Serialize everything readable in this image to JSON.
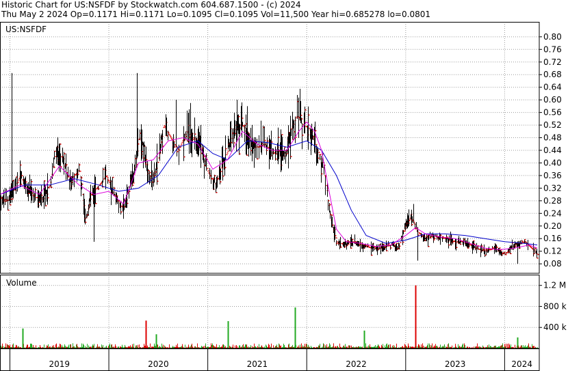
{
  "header": {
    "line1": "Historic Chart for US:NSFDF by Stockwatch.com 604.687.1500 - (c) 2024",
    "line2": "Thu May  2 2024   Op=0.1171  Hi=0.1171  Lo=0.1095  Cl=0.1095  Vol=11,500   Year hi=0.685278   lo=0.0801"
  },
  "colors": {
    "background": "#ffffff",
    "grid": "#9a9a9a",
    "border": "#000000",
    "price_bar": "#000000",
    "close_tick": "#dd0000",
    "ma_short": "#dd00dd",
    "ma_long": "#0000cc",
    "volume_up": "#22aa22",
    "volume_down": "#dd0000"
  },
  "chart_data": [
    {
      "type": "line",
      "name": "price",
      "title": "US:NSFDF",
      "ylim": [
        0.05,
        0.83
      ],
      "y_ticks": [
        "0.80",
        "0.76",
        "0.72",
        "0.68",
        "0.64",
        "0.60",
        "0.56",
        "0.52",
        "0.48",
        "0.44",
        "0.40",
        "0.36",
        "0.32",
        "0.28",
        "0.24",
        "0.20",
        "0.16",
        "0.12",
        "0.08"
      ],
      "x_labels": [
        "2019",
        "2020",
        "2021",
        "2022",
        "2023",
        "2024"
      ],
      "x_range": [
        2018.9,
        2024.35
      ],
      "year_boundaries": [
        2019.0,
        2020.0,
        2021.0,
        2022.0,
        2023.0,
        2024.0
      ],
      "price_anchors": [
        [
          2018.9,
          0.29
        ],
        [
          2018.98,
          0.28
        ],
        [
          2019.03,
          0.31
        ],
        [
          2019.1,
          0.36
        ],
        [
          2019.18,
          0.31
        ],
        [
          2019.25,
          0.29
        ],
        [
          2019.33,
          0.29
        ],
        [
          2019.4,
          0.33
        ],
        [
          2019.45,
          0.42
        ],
        [
          2019.52,
          0.42
        ],
        [
          2019.6,
          0.34
        ],
        [
          2019.7,
          0.38
        ],
        [
          2019.76,
          0.22
        ],
        [
          2019.82,
          0.3
        ],
        [
          2019.9,
          0.33
        ],
        [
          2019.97,
          0.36
        ],
        [
          2020.05,
          0.3
        ],
        [
          2020.15,
          0.25
        ],
        [
          2020.2,
          0.32
        ],
        [
          2020.25,
          0.37
        ],
        [
          2020.3,
          0.48
        ],
        [
          2020.35,
          0.46
        ],
        [
          2020.4,
          0.34
        ],
        [
          2020.48,
          0.38
        ],
        [
          2020.55,
          0.52
        ],
        [
          2020.62,
          0.48
        ],
        [
          2020.7,
          0.44
        ],
        [
          2020.78,
          0.5
        ],
        [
          2020.85,
          0.48
        ],
        [
          2020.92,
          0.46
        ],
        [
          2021.0,
          0.37
        ],
        [
          2021.08,
          0.33
        ],
        [
          2021.15,
          0.4
        ],
        [
          2021.2,
          0.44
        ],
        [
          2021.28,
          0.52
        ],
        [
          2021.35,
          0.52
        ],
        [
          2021.42,
          0.47
        ],
        [
          2021.5,
          0.45
        ],
        [
          2021.58,
          0.46
        ],
        [
          2021.65,
          0.43
        ],
        [
          2021.72,
          0.44
        ],
        [
          2021.8,
          0.43
        ],
        [
          2021.85,
          0.52
        ],
        [
          2021.9,
          0.55
        ],
        [
          2021.96,
          0.52
        ],
        [
          2022.02,
          0.51
        ],
        [
          2022.1,
          0.45
        ],
        [
          2022.17,
          0.38
        ],
        [
          2022.24,
          0.22
        ],
        [
          2022.3,
          0.15
        ],
        [
          2022.38,
          0.14
        ],
        [
          2022.45,
          0.15
        ],
        [
          2022.55,
          0.14
        ],
        [
          2022.65,
          0.13
        ],
        [
          2022.75,
          0.13
        ],
        [
          2022.85,
          0.14
        ],
        [
          2022.92,
          0.13
        ],
        [
          2023.0,
          0.2
        ],
        [
          2023.05,
          0.23
        ],
        [
          2023.12,
          0.18
        ],
        [
          2023.2,
          0.16
        ],
        [
          2023.28,
          0.17
        ],
        [
          2023.4,
          0.16
        ],
        [
          2023.5,
          0.15
        ],
        [
          2023.6,
          0.15
        ],
        [
          2023.7,
          0.13
        ],
        [
          2023.8,
          0.12
        ],
        [
          2023.9,
          0.13
        ],
        [
          2024.0,
          0.11
        ],
        [
          2024.1,
          0.14
        ],
        [
          2024.2,
          0.15
        ],
        [
          2024.3,
          0.12
        ],
        [
          2024.33,
          0.1095
        ]
      ],
      "ma_short": [
        [
          2018.9,
          0.3
        ],
        [
          2019.1,
          0.33
        ],
        [
          2019.3,
          0.3
        ],
        [
          2019.5,
          0.39
        ],
        [
          2019.7,
          0.33
        ],
        [
          2019.85,
          0.3
        ],
        [
          2020.0,
          0.31
        ],
        [
          2020.15,
          0.27
        ],
        [
          2020.3,
          0.4
        ],
        [
          2020.45,
          0.41
        ],
        [
          2020.6,
          0.47
        ],
        [
          2020.75,
          0.48
        ],
        [
          2020.9,
          0.46
        ],
        [
          2021.05,
          0.38
        ],
        [
          2021.2,
          0.41
        ],
        [
          2021.35,
          0.5
        ],
        [
          2021.5,
          0.46
        ],
        [
          2021.65,
          0.44
        ],
        [
          2021.8,
          0.44
        ],
        [
          2021.92,
          0.5
        ],
        [
          2022.0,
          0.53
        ],
        [
          2022.08,
          0.5
        ],
        [
          2022.15,
          0.44
        ],
        [
          2022.22,
          0.32
        ],
        [
          2022.3,
          0.19
        ],
        [
          2022.4,
          0.15
        ],
        [
          2022.55,
          0.145
        ],
        [
          2022.7,
          0.135
        ],
        [
          2022.85,
          0.14
        ],
        [
          2023.0,
          0.17
        ],
        [
          2023.1,
          0.195
        ],
        [
          2023.2,
          0.175
        ],
        [
          2023.35,
          0.165
        ],
        [
          2023.5,
          0.16
        ],
        [
          2023.65,
          0.145
        ],
        [
          2023.8,
          0.13
        ],
        [
          2023.95,
          0.125
        ],
        [
          2024.1,
          0.13
        ],
        [
          2024.25,
          0.14
        ],
        [
          2024.33,
          0.13
        ]
      ],
      "ma_long": [
        [
          2018.9,
          0.3
        ],
        [
          2019.15,
          0.33
        ],
        [
          2019.4,
          0.33
        ],
        [
          2019.65,
          0.35
        ],
        [
          2019.9,
          0.33
        ],
        [
          2020.1,
          0.31
        ],
        [
          2020.3,
          0.32
        ],
        [
          2020.5,
          0.36
        ],
        [
          2020.7,
          0.45
        ],
        [
          2020.9,
          0.47
        ],
        [
          2021.05,
          0.43
        ],
        [
          2021.2,
          0.41
        ],
        [
          2021.4,
          0.47
        ],
        [
          2021.6,
          0.465
        ],
        [
          2021.8,
          0.45
        ],
        [
          2022.0,
          0.47
        ],
        [
          2022.15,
          0.44
        ],
        [
          2022.3,
          0.36
        ],
        [
          2022.45,
          0.25
        ],
        [
          2022.6,
          0.17
        ],
        [
          2022.8,
          0.145
        ],
        [
          2023.0,
          0.155
        ],
        [
          2023.2,
          0.175
        ],
        [
          2023.4,
          0.175
        ],
        [
          2023.6,
          0.17
        ],
        [
          2023.8,
          0.16
        ],
        [
          2024.0,
          0.15
        ],
        [
          2024.2,
          0.145
        ],
        [
          2024.33,
          0.14
        ]
      ],
      "spikes": [
        [
          2019.02,
          0.685
        ],
        [
          2020.28,
          0.685
        ],
        [
          2020.68,
          0.6
        ],
        [
          2020.82,
          0.59
        ],
        [
          2021.93,
          0.635
        ],
        [
          2023.08,
          0.27
        ],
        [
          2023.12,
          0.09
        ],
        [
          2024.13,
          0.08
        ],
        [
          2019.85,
          0.15
        ],
        [
          2021.4,
          0.58
        ]
      ]
    },
    {
      "type": "bar",
      "name": "volume",
      "title": "Volume",
      "ylim": [
        0,
        1300000
      ],
      "y_ticks": [
        "1.2 M",
        "800 k",
        "400 k"
      ],
      "y_tick_values": [
        1200000,
        800000,
        400000
      ],
      "spikes": [
        [
          2020.37,
          530000,
          "down"
        ],
        [
          2021.2,
          520000,
          "up"
        ],
        [
          2021.88,
          780000,
          "up"
        ],
        [
          2023.1,
          1200000,
          "down"
        ],
        [
          2019.13,
          380000,
          "up"
        ],
        [
          2022.58,
          340000,
          "up"
        ],
        [
          2020.48,
          270000,
          "up"
        ],
        [
          2024.13,
          210000,
          "up"
        ]
      ]
    }
  ]
}
